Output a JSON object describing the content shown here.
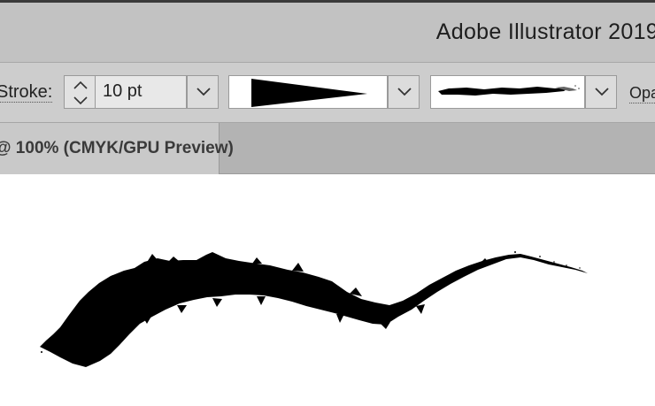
{
  "window": {
    "title": "Adobe Illustrator 2019"
  },
  "control_bar": {
    "stroke_label": "Stroke:",
    "stroke_weight": "10 pt",
    "variable_width_profile": "uniform-taper",
    "brush": "charcoal-brush",
    "opacity_label": "Opacity"
  },
  "document_tab": {
    "label": "@ 100% (CMYK/GPU Preview)"
  },
  "colors": {
    "ui_gray": "#cdcdcd",
    "stroke": "#000000",
    "artboard": "#ffffff"
  }
}
